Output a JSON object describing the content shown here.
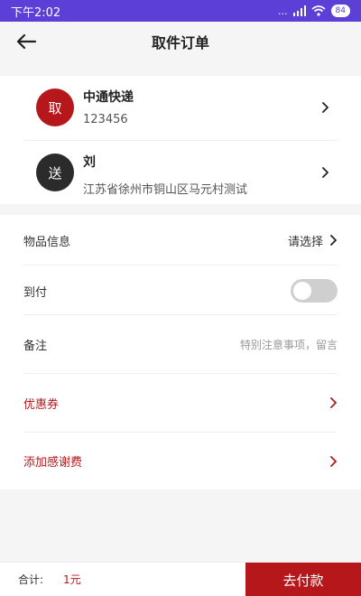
{
  "status_bar": {
    "time": "下午2:02",
    "network": "...",
    "battery": "84"
  },
  "header": {
    "title": "取件订单"
  },
  "pickup": {
    "badge": "取",
    "name": "中通快递",
    "code": "123456"
  },
  "delivery": {
    "badge": "送",
    "name": "刘",
    "address": "江苏省徐州市铜山区马元村测试"
  },
  "form": {
    "item_info_label": "物品信息",
    "item_info_value": "请选择",
    "cod_label": "到付",
    "cod_enabled": false,
    "remark_label": "备注",
    "remark_placeholder": "特别注意事项，留言",
    "coupon_label": "优惠券",
    "tip_label": "添加感谢费"
  },
  "footer": {
    "total_label": "合计:",
    "total_value": "1元",
    "pay_label": "去付款"
  },
  "colors": {
    "status_bar": "#5b3fd6",
    "accent_red": "#b5171b",
    "pickup_badge": "#b5171b",
    "delivery_badge": "#2b2b2b",
    "toggle_off": "#cfcfcf"
  }
}
